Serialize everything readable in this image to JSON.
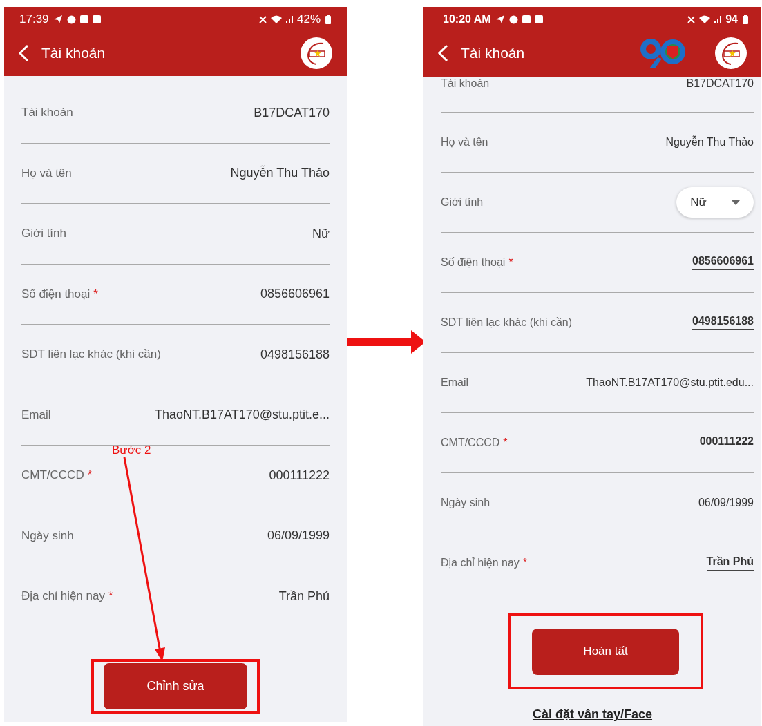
{
  "screens": [
    {
      "status_bar": {
        "time": "17:39",
        "battery": "42%"
      },
      "app_bar": {
        "title": "Tài khoản",
        "anniversary_logo": false
      },
      "fields": [
        {
          "kind": "text",
          "label": "Tài khoản",
          "value": "B17DCAT170"
        },
        {
          "kind": "text",
          "label": "Họ và tên",
          "value": "Nguyễn Thu Thảo"
        },
        {
          "kind": "text",
          "label": "Giới tính",
          "value": "Nữ"
        },
        {
          "kind": "text",
          "label": "Số điện thoại",
          "value": "0856606961",
          "required_mark": "*"
        },
        {
          "kind": "text",
          "label": "SDT liên lạc khác (khi cần)",
          "value": "0498156188"
        },
        {
          "kind": "text",
          "label": "Email",
          "value": "ThaoNT.B17AT170@stu.ptit.e..."
        },
        {
          "kind": "text",
          "label": "CMT/CCCD",
          "value": "000111222",
          "required_mark": "*"
        },
        {
          "kind": "text",
          "label": "Ngày sinh",
          "value": "06/09/1999"
        },
        {
          "kind": "text",
          "label": "Địa chỉ hiện nay",
          "value": "Trần Phú",
          "required_mark": "*"
        }
      ],
      "button": {
        "label": "Chỉnh sửa",
        "highlighted": true
      },
      "annotation": {
        "step_label": "Bước 2"
      }
    },
    {
      "status_bar": {
        "time": "10:20 AM",
        "battery": "94"
      },
      "app_bar": {
        "title": "Tài khoản",
        "anniversary_logo": true
      },
      "fields": [
        {
          "kind": "text",
          "label": "Tài khoản",
          "value": "B17DCAT170"
        },
        {
          "kind": "text",
          "label": "Họ và tên",
          "value": "Nguyễn Thu Thảo"
        },
        {
          "kind": "select",
          "label": "Giới tính",
          "value": "Nữ"
        },
        {
          "kind": "editable",
          "label": "Số điện thoại",
          "value": "0856606961",
          "required_mark": "*"
        },
        {
          "kind": "editable",
          "label": "SDT liên lạc khác (khi cần)",
          "value": "0498156188"
        },
        {
          "kind": "text",
          "label": "Email",
          "value": "ThaoNT.B17AT170@stu.ptit.edu..."
        },
        {
          "kind": "editable",
          "label": "CMT/CCCD",
          "value": "000111222",
          "required_mark": "*"
        },
        {
          "kind": "text",
          "label": "Ngày sinh",
          "value": "06/09/1999"
        },
        {
          "kind": "editable",
          "label": "Địa chỉ hiện nay",
          "value": "Trần Phú",
          "required_mark": "*"
        }
      ],
      "button": {
        "label": "Hoàn tất",
        "highlighted": true
      },
      "link": "Cài đặt vân tay/Face"
    }
  ]
}
